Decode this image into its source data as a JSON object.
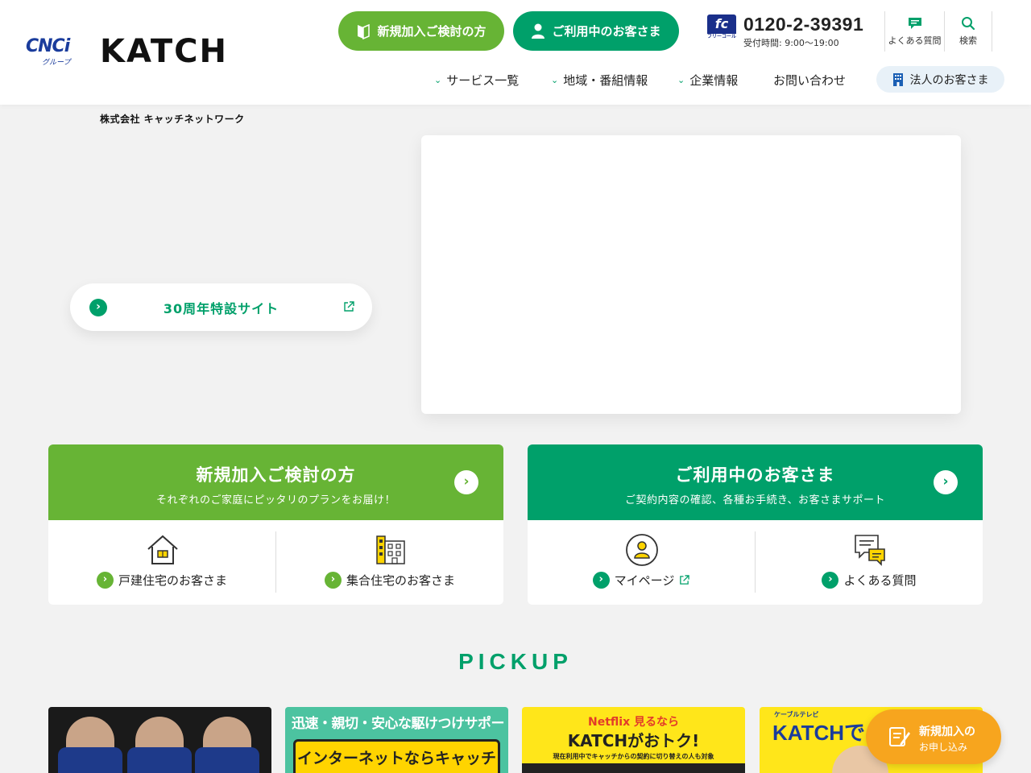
{
  "header": {
    "cnci_logo": "CNCi",
    "cnci_group": "グループ",
    "brand": "KATCH",
    "brand_sub": "株式会社 キャッチネットワーク",
    "btn_new": "新規加入ご検討の方",
    "btn_current": "ご利用中のお客さま",
    "phone_badge": "fc",
    "phone_badge_sub": "フリーコール",
    "phone": "0120-2-39391",
    "hours": "受付時間: 9:00〜19:00",
    "faq": "よくある質問",
    "search": "検索",
    "nav": [
      "サービス一覧",
      "地域・番組情報",
      "企業情報",
      "お問い合わせ"
    ],
    "corp": "法人のお客さま"
  },
  "hero": {
    "anniv_label": "30周年特設サイト"
  },
  "cards": {
    "new": {
      "title": "新規加入ご検討の方",
      "desc": "それぞれのご家庭にピッタリのプランをお届け！",
      "left": "戸建住宅のお客さま",
      "right": "集合住宅のお客さま"
    },
    "current": {
      "title": "ご利用中のお客さま",
      "desc": "ご契約内容の確認、各種お手続き、お客さまサポート",
      "left": "マイページ",
      "right": "よくある質問"
    }
  },
  "pickup": {
    "title": "PICKUP",
    "b2_line1": "迅速・親切・安心な駆けつけサポートも。",
    "b2_line2": "インターネットならキャッチ",
    "b3_line1": "Netflix 見るなら",
    "b3_line2": "KATCHがおトク!",
    "b3_line3": "現在利用中でキャッチからの契約に切り替えの人も対象",
    "b4_line1": "ケーブルテレビ",
    "b4_line2": "KATCHで"
  },
  "float": {
    "line1": "新規加入の",
    "line2": "お申し込み"
  },
  "colors": {
    "green_new": "#67b435",
    "green_current": "#00a06a",
    "orange": "#f7a51e",
    "navy": "#1a3c9c"
  }
}
